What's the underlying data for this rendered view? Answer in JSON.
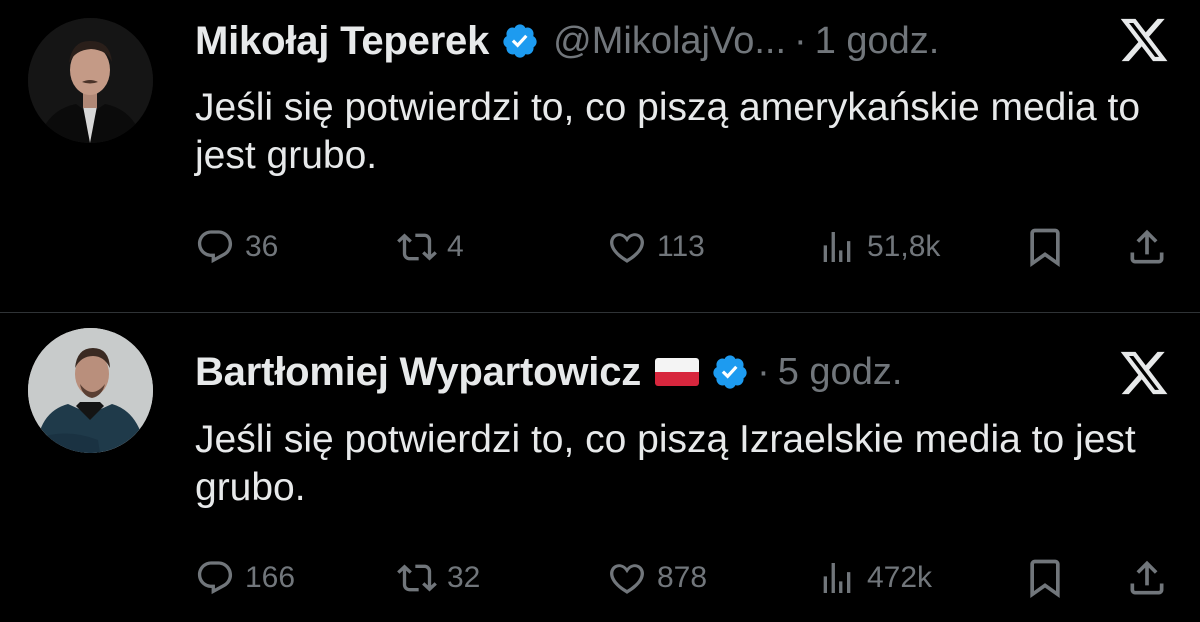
{
  "tweets": [
    {
      "author_name": "Mikołaj Teperek",
      "handle": "@MikolajVo...",
      "separator": "·",
      "time": "1 godz.",
      "verified": true,
      "flag": null,
      "text": "Jeśli się potwierdzi to, co piszą amerykańskie media to jest grubo.",
      "replies": "36",
      "reposts": "4",
      "likes": "113",
      "views": "51,8k"
    },
    {
      "author_name": "Bartłomiej Wypartowicz",
      "handle": "",
      "separator": "·",
      "time": "5 godz.",
      "verified": true,
      "flag": "poland-flag",
      "text": "Jeśli się potwierdzi to, co piszą Izraelskie media to jest grubo.",
      "replies": "166",
      "reposts": "32",
      "likes": "878",
      "views": "472k"
    }
  ],
  "icons": {
    "reply": "reply-icon",
    "repost": "repost-icon",
    "like": "heart-icon",
    "views": "views-icon",
    "bookmark": "bookmark-icon",
    "share": "share-icon",
    "brand": "x-logo-icon",
    "verified": "verified-badge-icon"
  },
  "colors": {
    "background": "#000000",
    "text": "#e7e9ea",
    "secondary": "#71767b",
    "verified": "#1d9bf0",
    "divider": "#2f3336"
  }
}
